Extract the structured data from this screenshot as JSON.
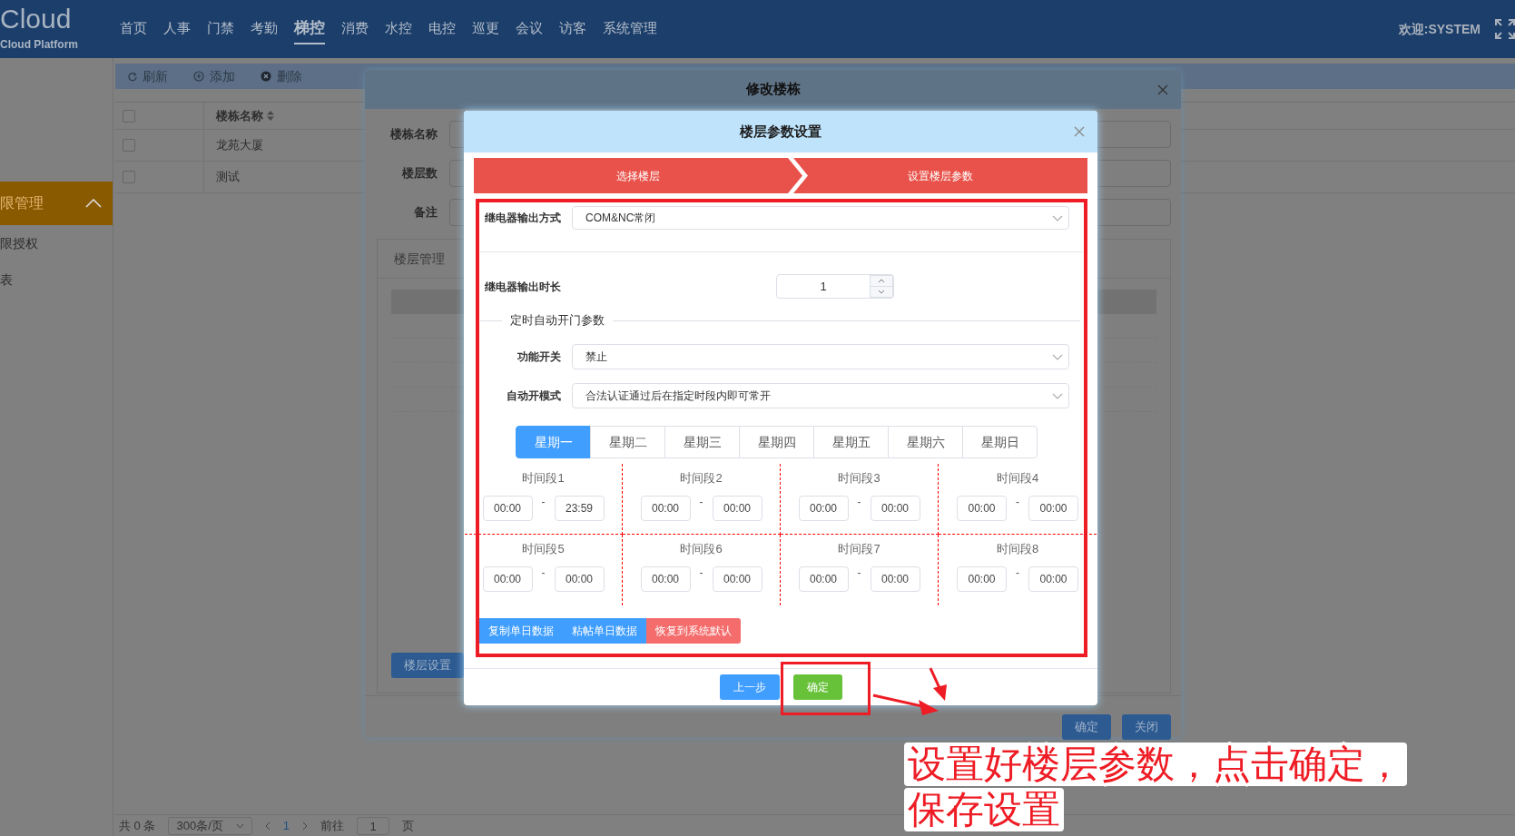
{
  "header": {
    "logo": "Cloud",
    "subtitle": "Cloud Platform",
    "nav": [
      {
        "label": "首页",
        "selected": false
      },
      {
        "label": "人事",
        "selected": false
      },
      {
        "label": "门禁",
        "selected": false
      },
      {
        "label": "考勤",
        "selected": false
      },
      {
        "label": "梯控",
        "selected": true
      },
      {
        "label": "消费",
        "selected": false
      },
      {
        "label": "水控",
        "selected": false
      },
      {
        "label": "电控",
        "selected": false
      },
      {
        "label": "巡更",
        "selected": false
      },
      {
        "label": "会议",
        "selected": false
      },
      {
        "label": "访客",
        "selected": false
      },
      {
        "label": "系统管理",
        "selected": false
      }
    ],
    "welcome": "欢迎:SYSTEM"
  },
  "sidebar": {
    "items": [
      {
        "label": "限管理",
        "kind": "group",
        "expanded": true
      },
      {
        "label": "限授权",
        "kind": "link"
      },
      {
        "label": "表",
        "kind": "link"
      }
    ]
  },
  "toolbar": [
    {
      "label": "刷新",
      "kind": "refresh"
    },
    {
      "label": "添加",
      "kind": "add"
    },
    {
      "label": "删除",
      "kind": "delete"
    }
  ],
  "table": {
    "columns": [
      "楼栋名称"
    ],
    "header_checked": false,
    "rows": [
      {
        "name": "龙苑大厦",
        "checked": false
      },
      {
        "name": "测试",
        "checked": false
      }
    ]
  },
  "pagination": {
    "total": "共 0 条",
    "page_size": "300条/页",
    "current": "1",
    "goto": "前往",
    "goto_value": "1",
    "page_unit": "页"
  },
  "outer_dialog": {
    "title": "修改楼栋",
    "fields": [
      "楼栋名称",
      "楼层数",
      "备注"
    ],
    "panel_title": "楼层管理",
    "panel_button": "楼层设置",
    "buttons": [
      "确定",
      "关闭"
    ]
  },
  "dialog": {
    "title": "楼层参数设置",
    "steps": [
      "选择楼层",
      "设置楼层参数"
    ],
    "relay_mode": {
      "label": "继电器输出方式",
      "value": "COM&NC常闭"
    },
    "relay_duration": {
      "label": "继电器输出时长",
      "value": "1"
    },
    "section": "定时自动开门参数",
    "switch": {
      "label": "功能开关",
      "value": "禁止"
    },
    "auto_mode": {
      "label": "自动开模式",
      "value": "合法认证通过后在指定时段内即可常开"
    },
    "days": [
      {
        "label": "星期一",
        "selected": true
      },
      {
        "label": "星期二",
        "selected": false
      },
      {
        "label": "星期三",
        "selected": false
      },
      {
        "label": "星期四",
        "selected": false
      },
      {
        "label": "星期五",
        "selected": false
      },
      {
        "label": "星期六",
        "selected": false
      },
      {
        "label": "星期日",
        "selected": false
      }
    ],
    "range_separator": "-",
    "slots": [
      {
        "label": "时间段1",
        "start": "00:00",
        "end": "23:59"
      },
      {
        "label": "时间段2",
        "start": "00:00",
        "end": "00:00"
      },
      {
        "label": "时间段3",
        "start": "00:00",
        "end": "00:00"
      },
      {
        "label": "时间段4",
        "start": "00:00",
        "end": "00:00"
      },
      {
        "label": "时间段5",
        "start": "00:00",
        "end": "00:00"
      },
      {
        "label": "时间段6",
        "start": "00:00",
        "end": "00:00"
      },
      {
        "label": "时间段7",
        "start": "00:00",
        "end": "00:00"
      },
      {
        "label": "时间段8",
        "start": "00:00",
        "end": "00:00"
      }
    ],
    "actions": [
      {
        "label": "复制单日数据",
        "kind": "primary"
      },
      {
        "label": "粘帖单日数据",
        "kind": "primary"
      },
      {
        "label": "恢复到系统默认",
        "kind": "danger"
      }
    ],
    "footer": [
      {
        "label": "上一步",
        "kind": "primary"
      },
      {
        "label": "确定",
        "kind": "success"
      }
    ]
  },
  "callout": {
    "lines": [
      "设置好楼层参数，点击确定，",
      "保存设置"
    ]
  }
}
